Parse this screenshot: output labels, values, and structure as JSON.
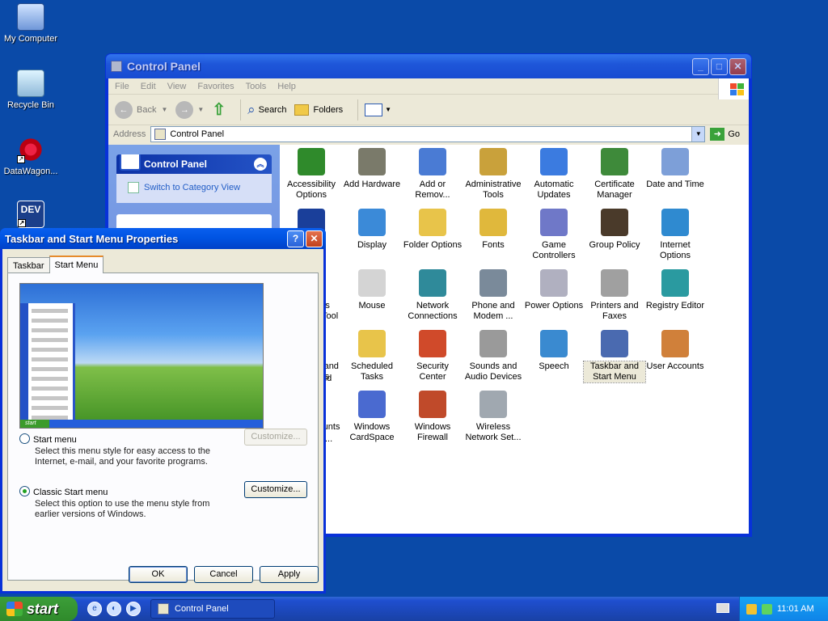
{
  "desktop": {
    "icons": [
      {
        "label": "My Computer"
      },
      {
        "label": "Recycle Bin"
      },
      {
        "label": "DataWagon..."
      },
      {
        "label": "DEV"
      }
    ]
  },
  "control_panel": {
    "title": "Control Panel",
    "menu": [
      "File",
      "Edit",
      "View",
      "Favorites",
      "Tools",
      "Help"
    ],
    "toolbar": {
      "back": "Back",
      "search": "Search",
      "folders": "Folders"
    },
    "address_label": "Address",
    "address_value": "Control Panel",
    "go": "Go",
    "left_pane": {
      "title": "Control Panel",
      "switch_link": "Switch to Category View"
    },
    "items": [
      {
        "line1": "Accessibility",
        "line2": "Options",
        "color": "#2f8a2b"
      },
      {
        "line1": "Add Hardware",
        "line2": "",
        "color": "#7a7a6a"
      },
      {
        "line1": "Add or",
        "line2": "Remov...",
        "color": "#4a7bd4"
      },
      {
        "line1": "Administrative",
        "line2": "Tools",
        "color": "#c9a13b"
      },
      {
        "line1": "Automatic",
        "line2": "Updates",
        "color": "#3b7be0"
      },
      {
        "line1": "Certificate",
        "line2": "Manager",
        "color": "#3e8a3a"
      },
      {
        "line1": "Date and Time",
        "line2": "",
        "color": "#7d9fd8"
      },
      {
        "line1": "",
        "line2": "",
        "color": "#1a3f9a"
      },
      {
        "line1": "Display",
        "line2": "",
        "color": "#3b8ad8"
      },
      {
        "line1": "Folder Options",
        "line2": "",
        "color": "#e8c44a"
      },
      {
        "line1": "Fonts",
        "line2": "",
        "color": "#e0b83c"
      },
      {
        "line1": "Game",
        "line2": "Controllers",
        "color": "#6f78c8"
      },
      {
        "line1": "Group Policy",
        "line2": "",
        "color": "#4a3a2a"
      },
      {
        "line1": "Internet",
        "line2": "Options",
        "color": "#2f8ad0"
      },
      {
        "line1": "Malicious",
        "line2": "Removal Tool",
        "color": "#8fa3c0"
      },
      {
        "line1": "Mouse",
        "line2": "",
        "color": "#d4d4d4"
      },
      {
        "line1": "Network",
        "line2": "Connections",
        "color": "#2f8a9a"
      },
      {
        "line1": "Phone and",
        "line2": "Modem ...",
        "color": "#7a8a9a"
      },
      {
        "line1": "Power Options",
        "line2": "",
        "color": "#b0b0c0"
      },
      {
        "line1": "Printers and",
        "line2": "Faxes",
        "color": "#a0a0a0"
      },
      {
        "line1": "Registry Editor",
        "line2": "",
        "color": "#2a9aa0"
      },
      {
        "line1": "Scanners and",
        "line2": "Cameras",
        "color": "#8a9ab0"
      },
      {
        "line1": "Scheduled",
        "line2": "Tasks",
        "color": "#e8c44a"
      },
      {
        "line1": "Security",
        "line2": "Center",
        "color": "#d04a2a"
      },
      {
        "line1": "Sounds and",
        "line2": "Audio Devices",
        "color": "#9a9a9a"
      },
      {
        "line1": "Speech",
        "line2": "",
        "color": "#3a8ad0"
      },
      {
        "line1": "Taskbar and",
        "line2": "Start Menu",
        "color": "#4a6ab0"
      },
      {
        "line1": "User Accounts",
        "line2": "",
        "color": "#d0803a"
      },
      {
        "line1": "User Accounts",
        "line2": "(W2k)",
        "color": "#c08030"
      },
      {
        "line1": "Windows",
        "line2": "CardSpace",
        "color": "#4a6ad0"
      },
      {
        "line1": "Windows",
        "line2": "Firewall",
        "color": "#c04a2a"
      },
      {
        "line1": "Wireless",
        "line2": "Network Set...",
        "color": "#a0a8b0"
      }
    ],
    "hidden_fragments": {
      "r4": "nd",
      "r5": "..."
    }
  },
  "dialog": {
    "title": "Taskbar and Start Menu Properties",
    "tabs": [
      "Taskbar",
      "Start Menu"
    ],
    "preview_start": "start",
    "option1": {
      "label": "Start menu",
      "desc": "Select this menu style for easy access to the Internet, e-mail, and your favorite programs.",
      "button": "Customize..."
    },
    "option2": {
      "label": "Classic Start menu",
      "desc": "Select this option to use the menu style from earlier versions of Windows.",
      "button": "Customize..."
    },
    "ok": "OK",
    "cancel": "Cancel",
    "apply": "Apply"
  },
  "taskbar": {
    "start": "start",
    "task": "Control Panel",
    "time": "11:01 AM"
  }
}
